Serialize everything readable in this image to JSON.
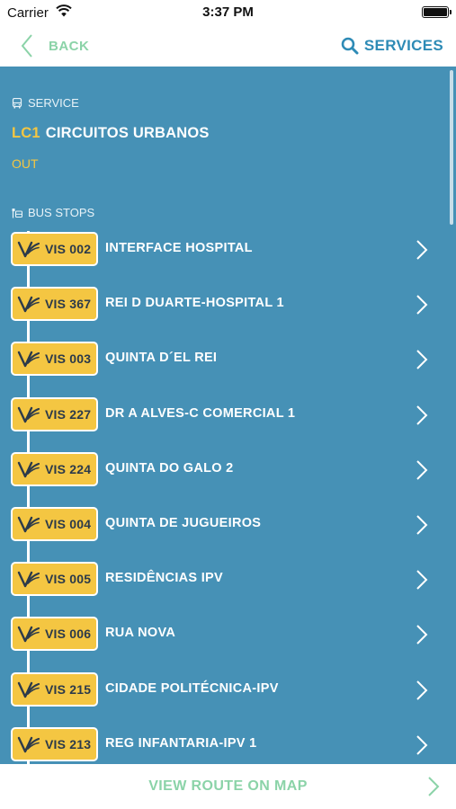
{
  "status_bar": {
    "carrier": "Carrier",
    "time": "3:37 PM"
  },
  "nav": {
    "back_label": "BACK",
    "services_label": "SERVICES"
  },
  "service": {
    "section_label": "SERVICE",
    "code": "LC1",
    "name": "CIRCUITOS URBANOS",
    "direction": "OUT"
  },
  "bus_stops": {
    "section_label": "BUS STOPS",
    "items": [
      {
        "code": "VIS 002",
        "name": "INTERFACE HOSPITAL"
      },
      {
        "code": "VIS 367",
        "name": "REI D DUARTE-HOSPITAL 1"
      },
      {
        "code": "VIS 003",
        "name": "QUINTA D´EL REI"
      },
      {
        "code": "VIS 227",
        "name": "DR A ALVES-C COMERCIAL 1"
      },
      {
        "code": "VIS 224",
        "name": "QUINTA DO GALO 2"
      },
      {
        "code": "VIS 004",
        "name": "QUINTA DE JUGUEIROS"
      },
      {
        "code": "VIS 005",
        "name": "RESIDÊNCIAS IPV"
      },
      {
        "code": "VIS 006",
        "name": "RUA NOVA"
      },
      {
        "code": "VIS 215",
        "name": "CIDADE POLITÉCNICA-IPV"
      },
      {
        "code": "VIS 213",
        "name": "REG INFANTARIA-IPV 1"
      }
    ]
  },
  "footer": {
    "label": "VIEW ROUTE ON MAP"
  },
  "colors": {
    "primary_blue": "#4691b6",
    "accent_yellow": "#f4c642",
    "accent_green": "#8bd3a8",
    "link_blue": "#2e8bb6"
  }
}
